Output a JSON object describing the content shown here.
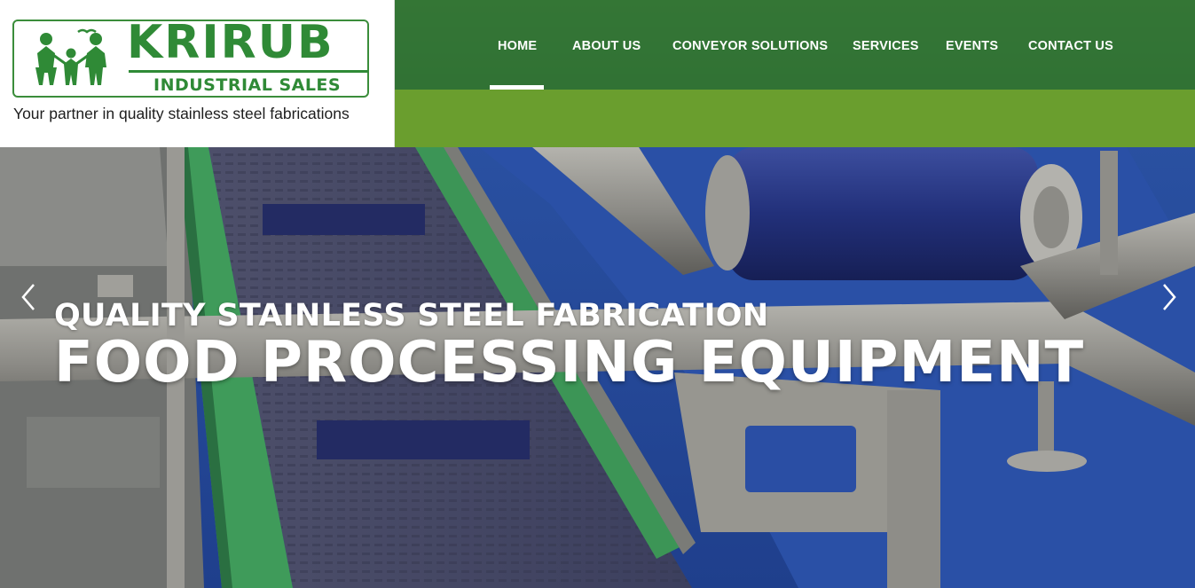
{
  "brand": {
    "name": "KRIRUB",
    "subtitle": "INDUSTRIAL SALES",
    "tagline": "Your partner in quality stainless steel fabrications",
    "color": "#2f8a36"
  },
  "nav": {
    "items": [
      {
        "label": "HOME",
        "active": true
      },
      {
        "label": "ABOUT US"
      },
      {
        "label": "CONVEYOR SOLUTIONS"
      },
      {
        "label": "SERVICES"
      },
      {
        "label": "EVENTS"
      },
      {
        "label": "CONTACT US"
      }
    ],
    "bar_color": "#2e7034",
    "strip_color": "#6a9e2e"
  },
  "slider": {
    "subtitle": "QUALITY STAINLESS STEEL FABRICATION",
    "title": "FOOD PROCESSING EQUIPMENT",
    "prev_icon": "chevron-left-icon",
    "next_icon": "chevron-right-icon"
  }
}
